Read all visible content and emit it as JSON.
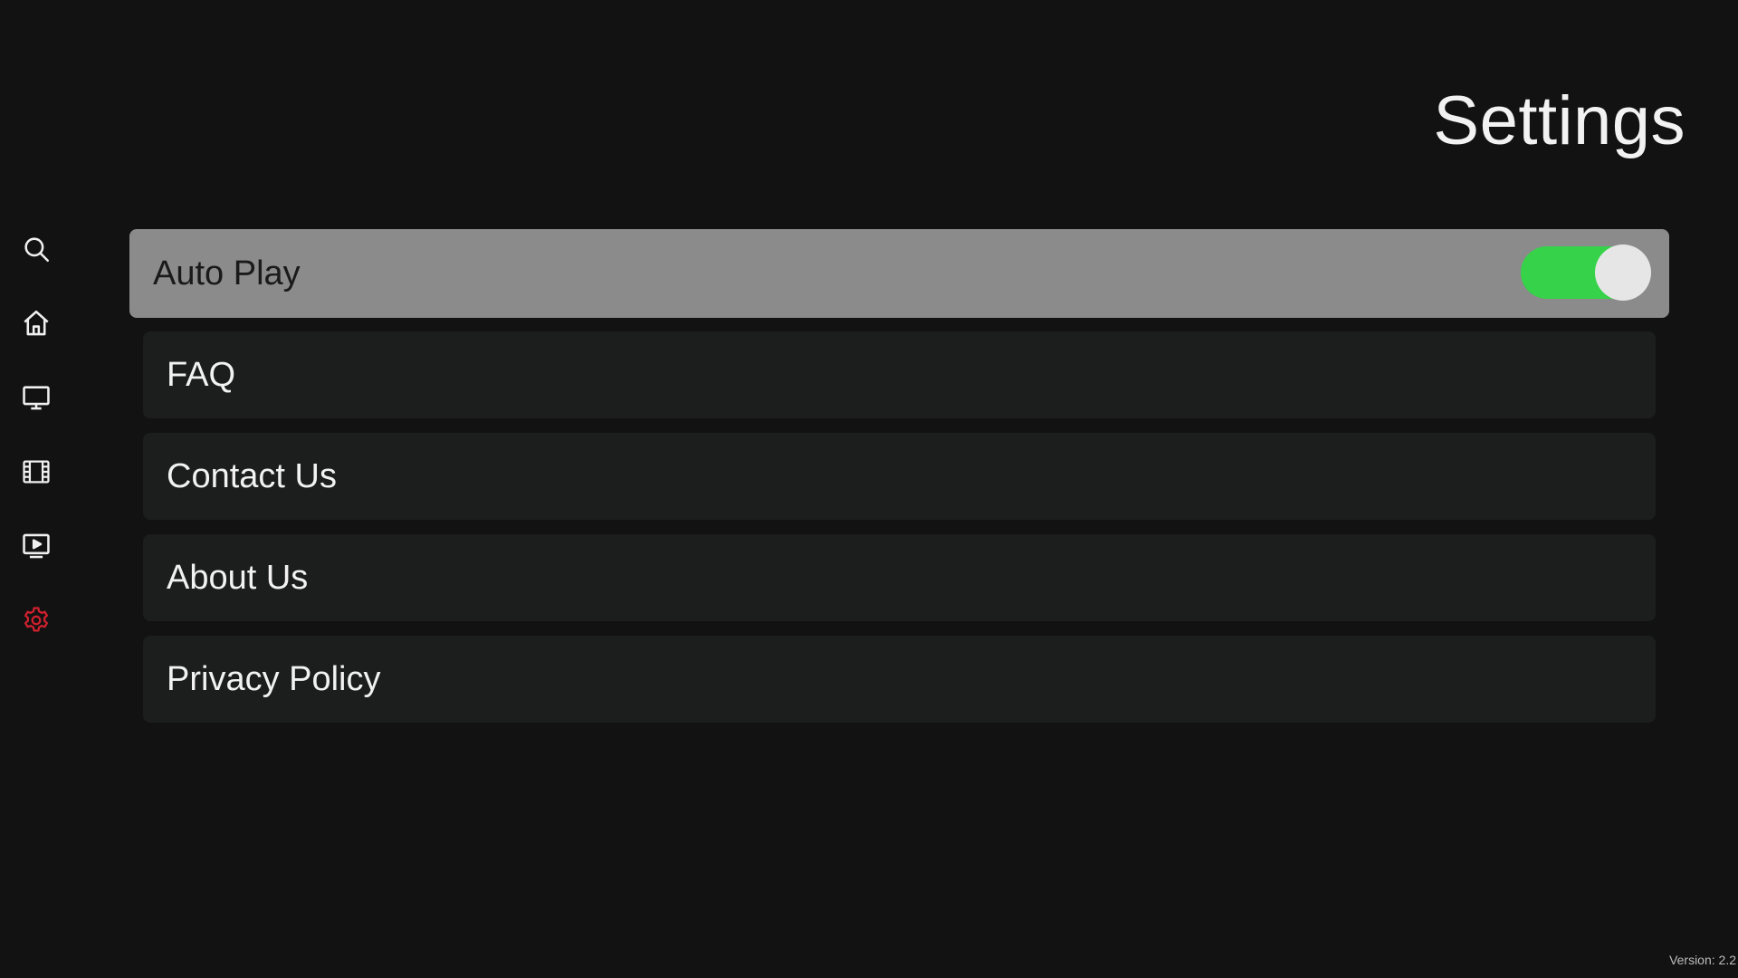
{
  "header": {
    "title": "Settings"
  },
  "sidebar": {
    "items": [
      {
        "icon": "search-icon",
        "active": false
      },
      {
        "icon": "home-icon",
        "active": false
      },
      {
        "icon": "tv-icon",
        "active": false
      },
      {
        "icon": "film-icon",
        "active": false
      },
      {
        "icon": "play-screen-icon",
        "active": false
      },
      {
        "icon": "gear-icon",
        "active": true
      }
    ],
    "icon_color": "#f0f0f0",
    "active_icon_color": "#d0202e"
  },
  "settings": {
    "auto_play": {
      "label": "Auto Play",
      "enabled": true,
      "toggle_on_color": "#36d24a"
    },
    "faq_label": "FAQ",
    "contact_label": "Contact Us",
    "about_label": "About Us",
    "privacy_label": "Privacy Policy"
  },
  "footer": {
    "version": "Version: 2.2"
  }
}
